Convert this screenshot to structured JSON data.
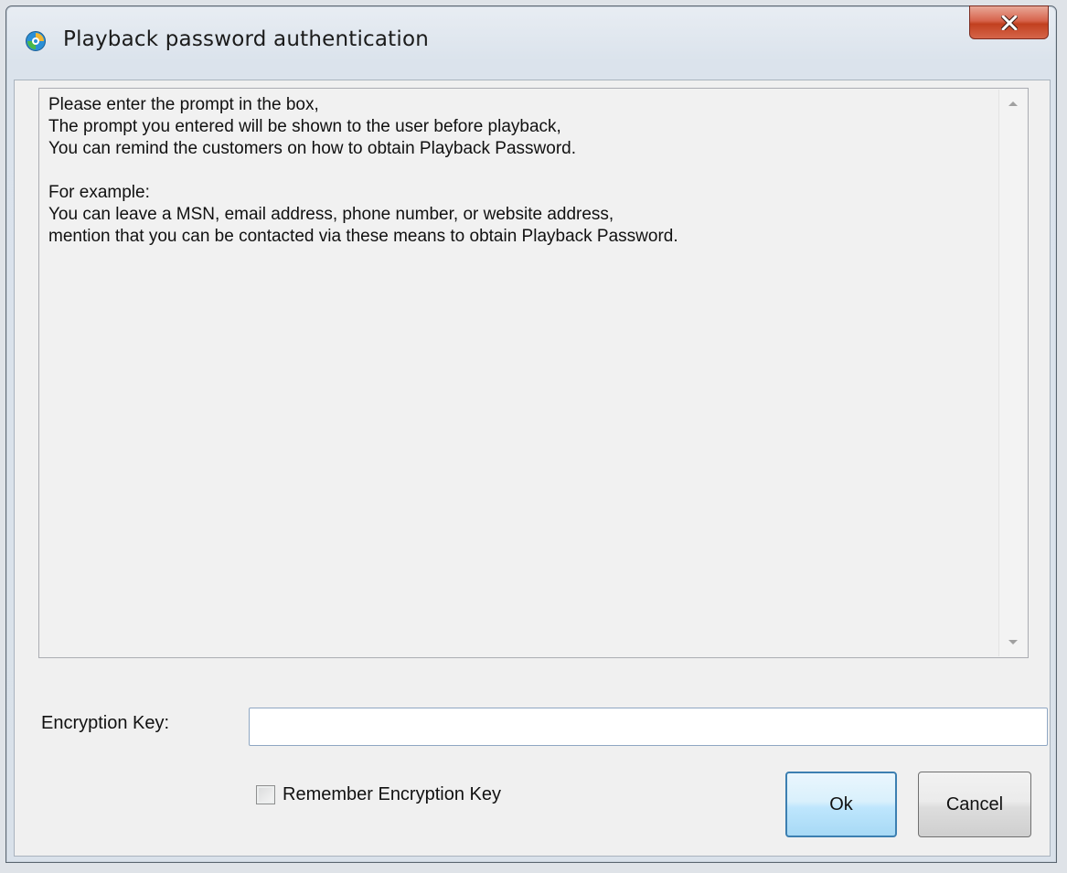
{
  "window": {
    "title": "Playback password authentication",
    "close_label": "X"
  },
  "prompt": {
    "text": "Please enter the prompt in the box,\nThe prompt you entered will be shown to the user before playback,\nYou can remind the customers on how to obtain Playback Password.\n\nFor example:\nYou can leave a MSN, email address, phone number, or website address,\nmention that you can be contacted via these means to obtain Playback Password."
  },
  "encryption": {
    "label": "Encryption Key:",
    "value": ""
  },
  "remember": {
    "label": "Remember Encryption Key",
    "checked": false
  },
  "buttons": {
    "ok_label": "Ok",
    "cancel_label": "Cancel"
  },
  "icons": {
    "app": "app-logo-icon",
    "close": "close-icon",
    "scroll_up": "arrow-up-icon",
    "scroll_down": "arrow-down-icon"
  },
  "colors": {
    "close_button": "#c9452a",
    "ok_border": "#3c7fb1",
    "client_background": "#f0f0f0"
  }
}
